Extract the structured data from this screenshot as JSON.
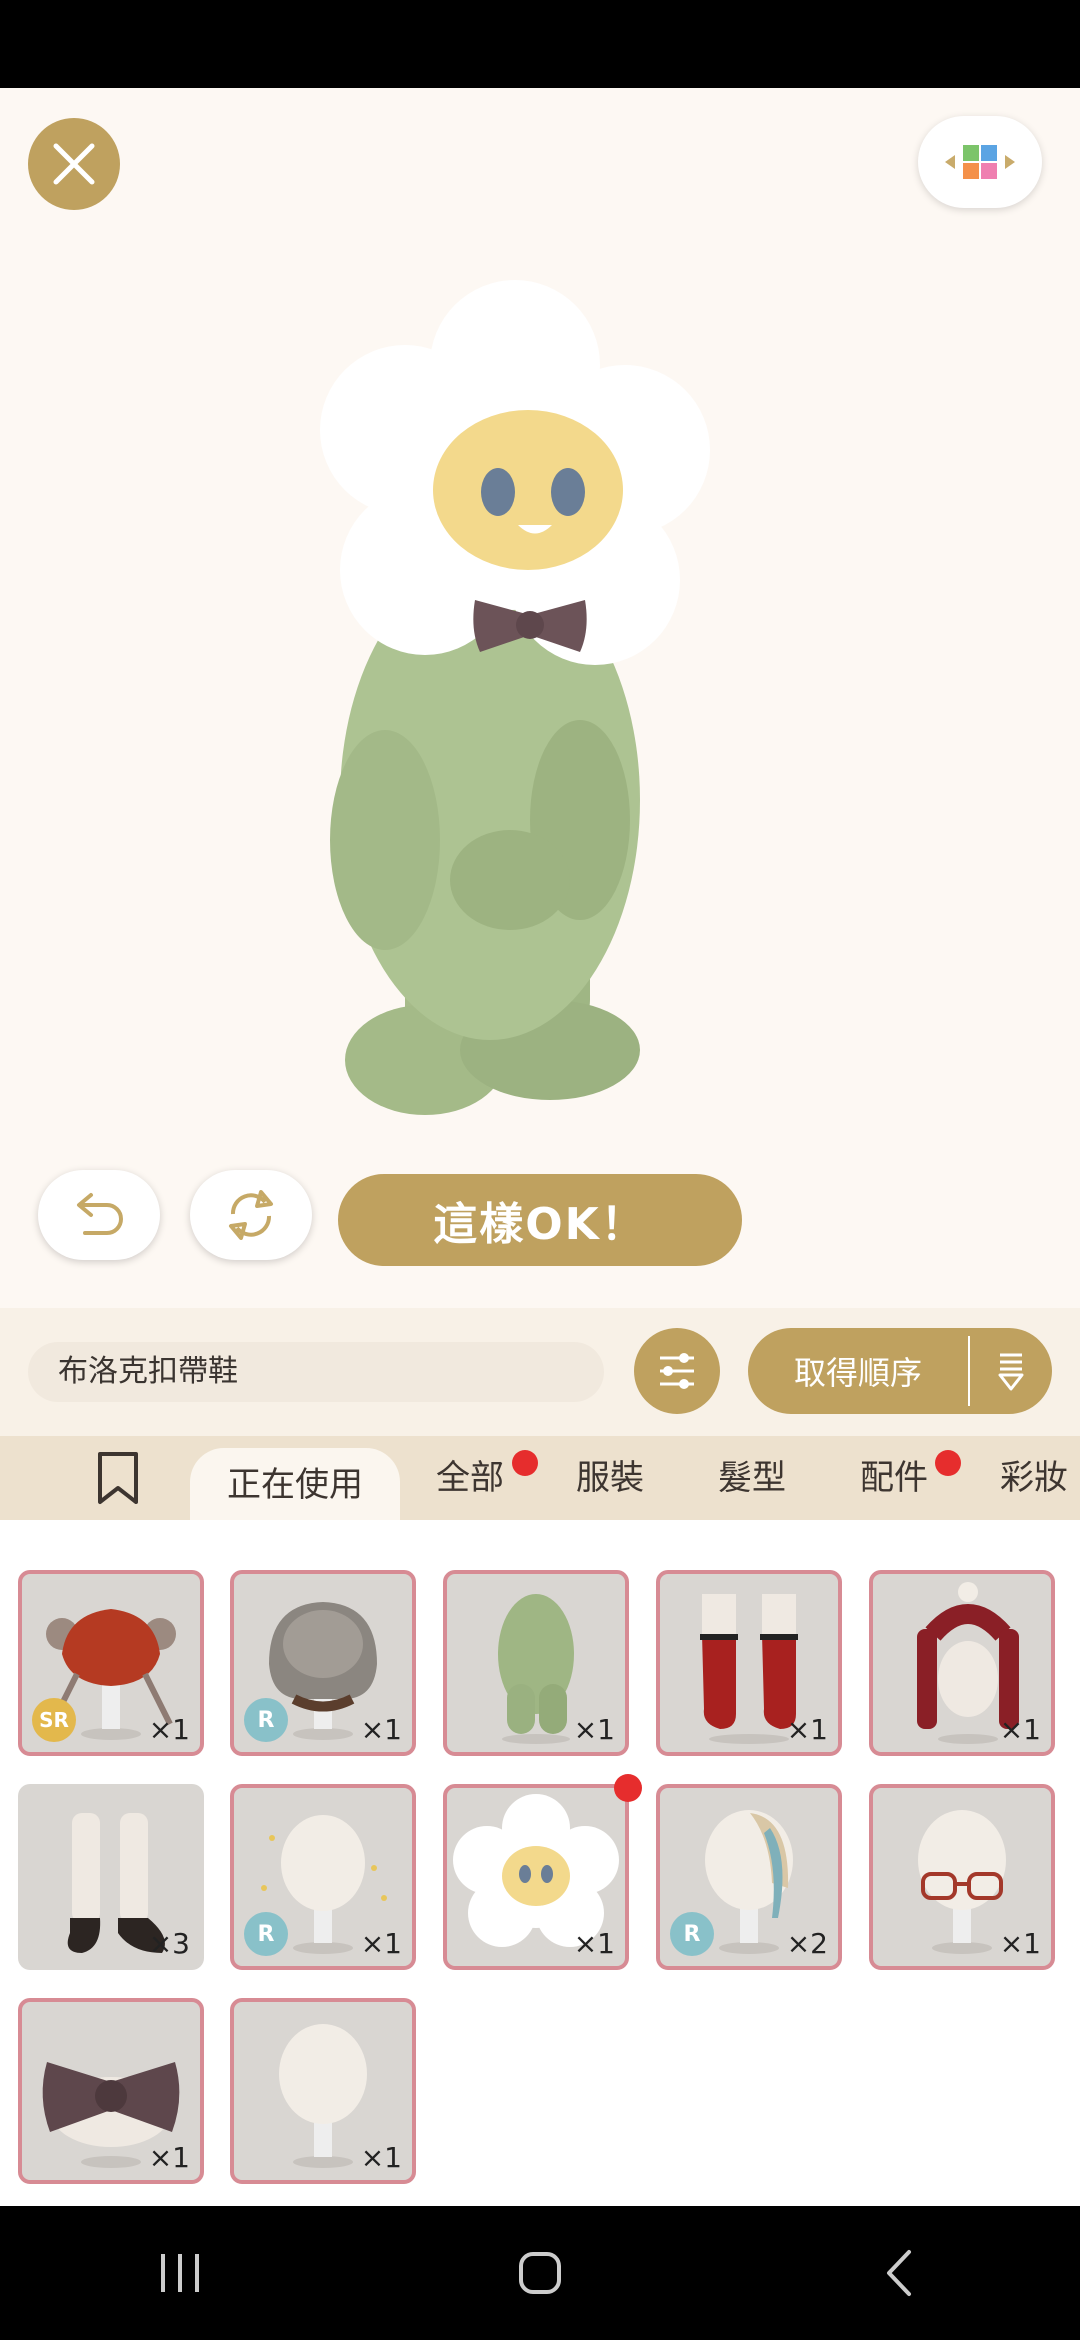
{
  "header": {
    "ok_label": "這樣OK！"
  },
  "search": {
    "value": "布洛克扣帶鞋"
  },
  "sort": {
    "label": "取得順序"
  },
  "tabs": [
    {
      "label": "正在使用",
      "active": true
    },
    {
      "label": "全部",
      "notify": true
    },
    {
      "label": "服裝"
    },
    {
      "label": "髮型"
    },
    {
      "label": "配件",
      "notify": true
    },
    {
      "label": "彩妝"
    }
  ],
  "items": [
    {
      "kind": "red-hair",
      "rarity": "SR",
      "qty": "×1"
    },
    {
      "kind": "grey-hair",
      "rarity": "R",
      "qty": "×1"
    },
    {
      "kind": "green-suit",
      "rarity": "",
      "qty": "×1"
    },
    {
      "kind": "red-socks",
      "rarity": "",
      "qty": "×1"
    },
    {
      "kind": "red-scarf",
      "rarity": "",
      "qty": "×1"
    },
    {
      "kind": "white-socks-shoes",
      "rarity": "",
      "qty": "×3"
    },
    {
      "kind": "sparkle-head",
      "rarity": "R",
      "qty": "×1"
    },
    {
      "kind": "flower-head",
      "rarity": "",
      "qty": "×1",
      "notify": true
    },
    {
      "kind": "blonde-hair",
      "rarity": "R",
      "qty": "×2"
    },
    {
      "kind": "glasses",
      "rarity": "",
      "qty": "×1"
    },
    {
      "kind": "bow-tie",
      "rarity": "",
      "qty": "×1"
    },
    {
      "kind": "blank-head",
      "rarity": "",
      "qty": "×1"
    }
  ],
  "colors": {
    "accent": "#bfa15f",
    "card_border": "#d78b94",
    "notify": "#e62d2d"
  }
}
